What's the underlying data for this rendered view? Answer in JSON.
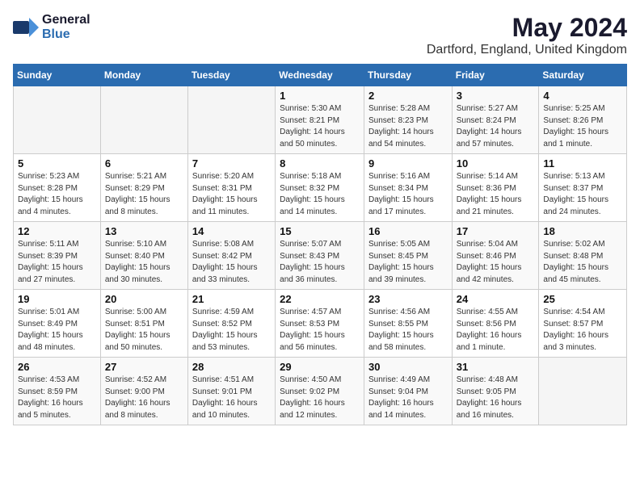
{
  "logo": {
    "general": "General",
    "blue": "Blue"
  },
  "title": "May 2024",
  "subtitle": "Dartford, England, United Kingdom",
  "headers": [
    "Sunday",
    "Monday",
    "Tuesday",
    "Wednesday",
    "Thursday",
    "Friday",
    "Saturday"
  ],
  "weeks": [
    [
      {
        "day": "",
        "info": ""
      },
      {
        "day": "",
        "info": ""
      },
      {
        "day": "",
        "info": ""
      },
      {
        "day": "1",
        "info": "Sunrise: 5:30 AM\nSunset: 8:21 PM\nDaylight: 14 hours\nand 50 minutes."
      },
      {
        "day": "2",
        "info": "Sunrise: 5:28 AM\nSunset: 8:23 PM\nDaylight: 14 hours\nand 54 minutes."
      },
      {
        "day": "3",
        "info": "Sunrise: 5:27 AM\nSunset: 8:24 PM\nDaylight: 14 hours\nand 57 minutes."
      },
      {
        "day": "4",
        "info": "Sunrise: 5:25 AM\nSunset: 8:26 PM\nDaylight: 15 hours\nand 1 minute."
      }
    ],
    [
      {
        "day": "5",
        "info": "Sunrise: 5:23 AM\nSunset: 8:28 PM\nDaylight: 15 hours\nand 4 minutes."
      },
      {
        "day": "6",
        "info": "Sunrise: 5:21 AM\nSunset: 8:29 PM\nDaylight: 15 hours\nand 8 minutes."
      },
      {
        "day": "7",
        "info": "Sunrise: 5:20 AM\nSunset: 8:31 PM\nDaylight: 15 hours\nand 11 minutes."
      },
      {
        "day": "8",
        "info": "Sunrise: 5:18 AM\nSunset: 8:32 PM\nDaylight: 15 hours\nand 14 minutes."
      },
      {
        "day": "9",
        "info": "Sunrise: 5:16 AM\nSunset: 8:34 PM\nDaylight: 15 hours\nand 17 minutes."
      },
      {
        "day": "10",
        "info": "Sunrise: 5:14 AM\nSunset: 8:36 PM\nDaylight: 15 hours\nand 21 minutes."
      },
      {
        "day": "11",
        "info": "Sunrise: 5:13 AM\nSunset: 8:37 PM\nDaylight: 15 hours\nand 24 minutes."
      }
    ],
    [
      {
        "day": "12",
        "info": "Sunrise: 5:11 AM\nSunset: 8:39 PM\nDaylight: 15 hours\nand 27 minutes."
      },
      {
        "day": "13",
        "info": "Sunrise: 5:10 AM\nSunset: 8:40 PM\nDaylight: 15 hours\nand 30 minutes."
      },
      {
        "day": "14",
        "info": "Sunrise: 5:08 AM\nSunset: 8:42 PM\nDaylight: 15 hours\nand 33 minutes."
      },
      {
        "day": "15",
        "info": "Sunrise: 5:07 AM\nSunset: 8:43 PM\nDaylight: 15 hours\nand 36 minutes."
      },
      {
        "day": "16",
        "info": "Sunrise: 5:05 AM\nSunset: 8:45 PM\nDaylight: 15 hours\nand 39 minutes."
      },
      {
        "day": "17",
        "info": "Sunrise: 5:04 AM\nSunset: 8:46 PM\nDaylight: 15 hours\nand 42 minutes."
      },
      {
        "day": "18",
        "info": "Sunrise: 5:02 AM\nSunset: 8:48 PM\nDaylight: 15 hours\nand 45 minutes."
      }
    ],
    [
      {
        "day": "19",
        "info": "Sunrise: 5:01 AM\nSunset: 8:49 PM\nDaylight: 15 hours\nand 48 minutes."
      },
      {
        "day": "20",
        "info": "Sunrise: 5:00 AM\nSunset: 8:51 PM\nDaylight: 15 hours\nand 50 minutes."
      },
      {
        "day": "21",
        "info": "Sunrise: 4:59 AM\nSunset: 8:52 PM\nDaylight: 15 hours\nand 53 minutes."
      },
      {
        "day": "22",
        "info": "Sunrise: 4:57 AM\nSunset: 8:53 PM\nDaylight: 15 hours\nand 56 minutes."
      },
      {
        "day": "23",
        "info": "Sunrise: 4:56 AM\nSunset: 8:55 PM\nDaylight: 15 hours\nand 58 minutes."
      },
      {
        "day": "24",
        "info": "Sunrise: 4:55 AM\nSunset: 8:56 PM\nDaylight: 16 hours\nand 1 minute."
      },
      {
        "day": "25",
        "info": "Sunrise: 4:54 AM\nSunset: 8:57 PM\nDaylight: 16 hours\nand 3 minutes."
      }
    ],
    [
      {
        "day": "26",
        "info": "Sunrise: 4:53 AM\nSunset: 8:59 PM\nDaylight: 16 hours\nand 5 minutes."
      },
      {
        "day": "27",
        "info": "Sunrise: 4:52 AM\nSunset: 9:00 PM\nDaylight: 16 hours\nand 8 minutes."
      },
      {
        "day": "28",
        "info": "Sunrise: 4:51 AM\nSunset: 9:01 PM\nDaylight: 16 hours\nand 10 minutes."
      },
      {
        "day": "29",
        "info": "Sunrise: 4:50 AM\nSunset: 9:02 PM\nDaylight: 16 hours\nand 12 minutes."
      },
      {
        "day": "30",
        "info": "Sunrise: 4:49 AM\nSunset: 9:04 PM\nDaylight: 16 hours\nand 14 minutes."
      },
      {
        "day": "31",
        "info": "Sunrise: 4:48 AM\nSunset: 9:05 PM\nDaylight: 16 hours\nand 16 minutes."
      },
      {
        "day": "",
        "info": ""
      }
    ]
  ]
}
